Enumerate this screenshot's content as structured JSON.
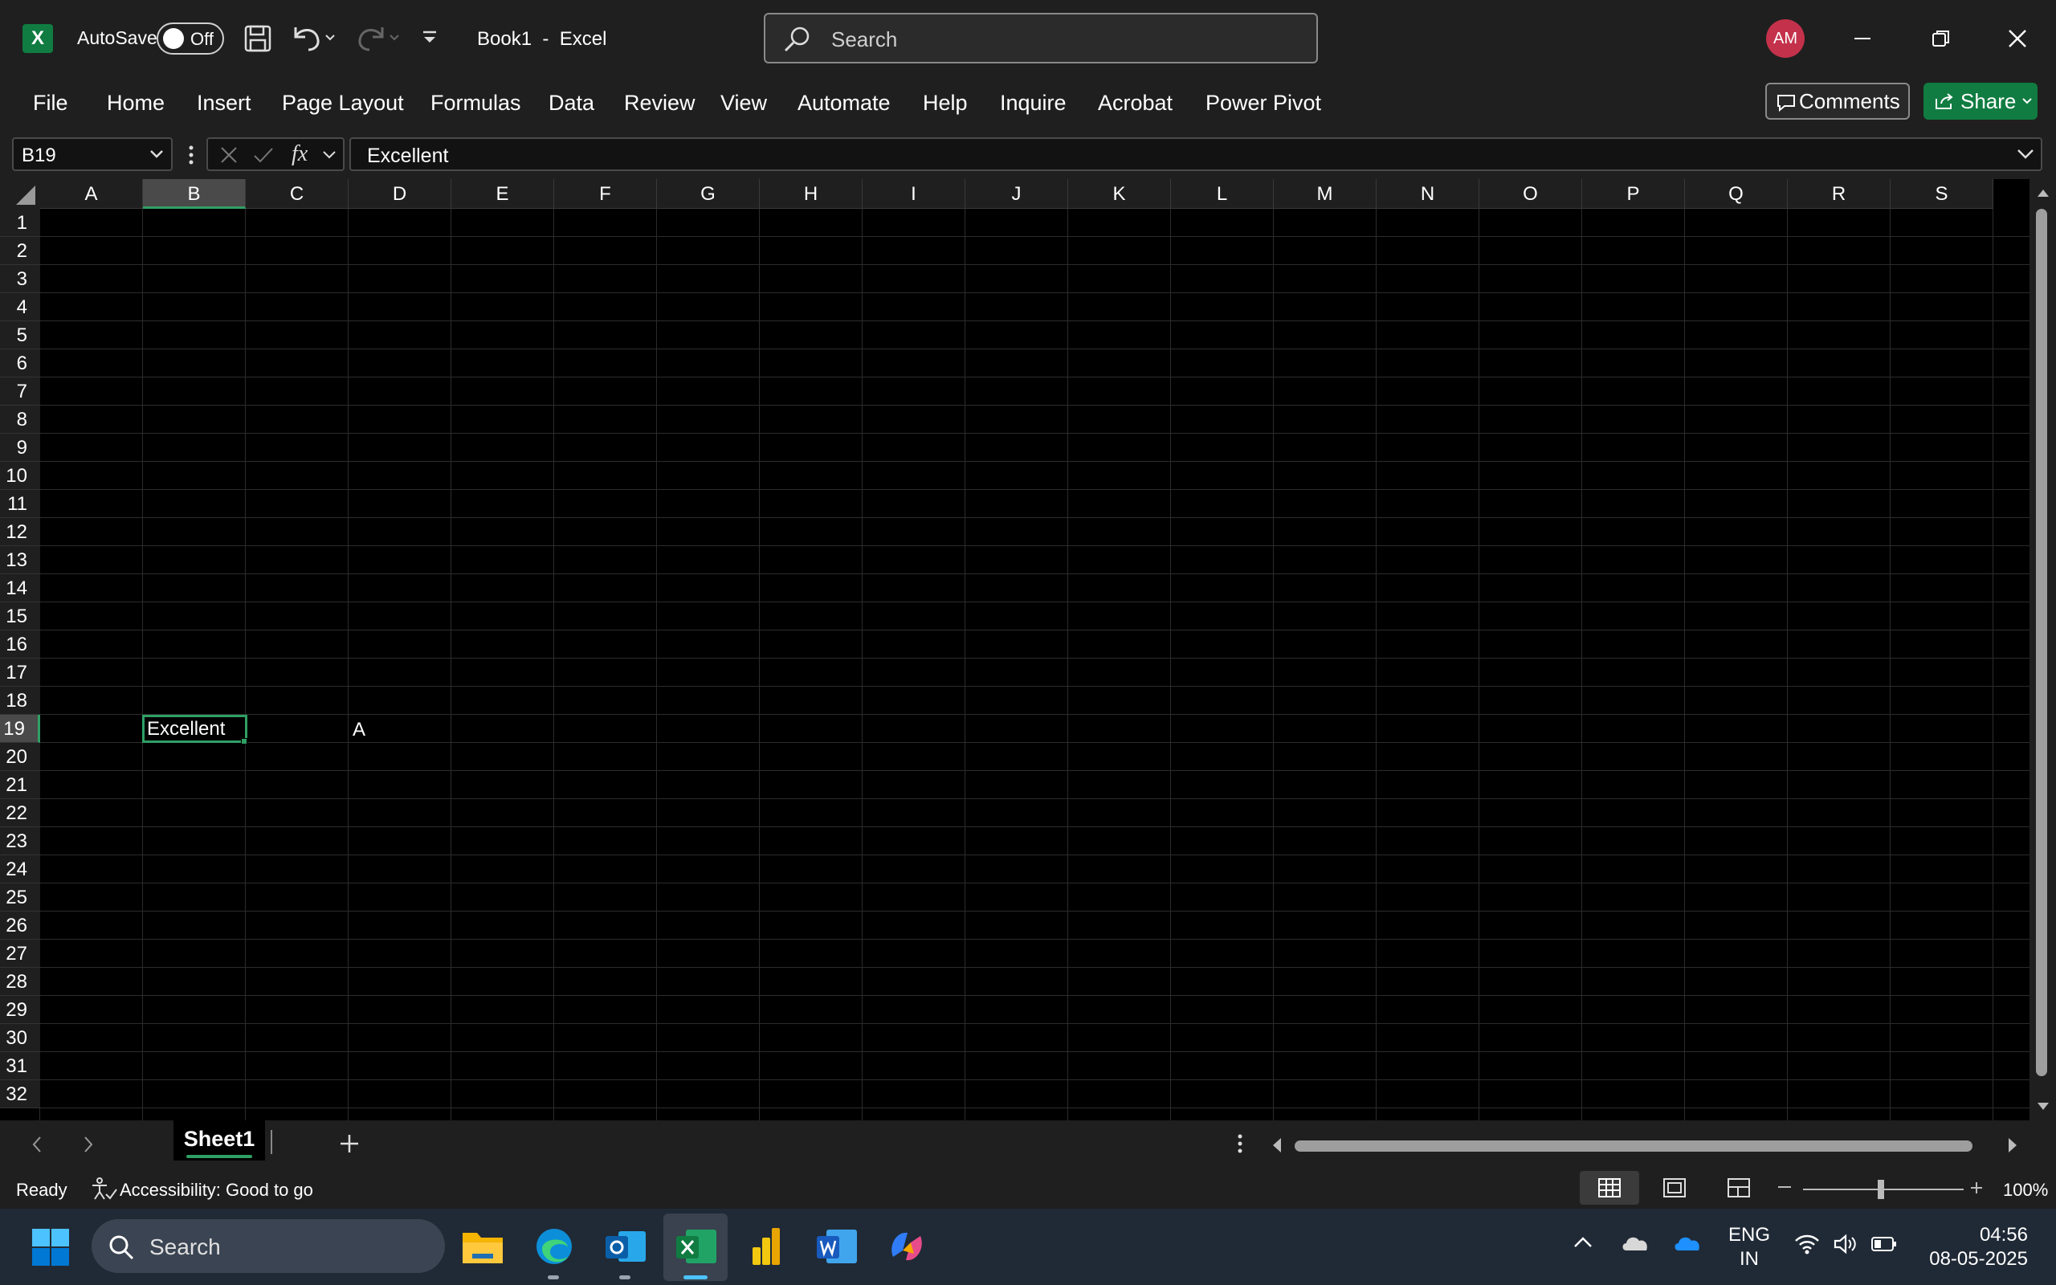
{
  "titlebar": {
    "app_icon_letter": "X",
    "autosave_label": "AutoSave",
    "autosave_state": "Off",
    "document_title": "Book1  -  Excel",
    "search_placeholder": "Search",
    "user_initials": "AM"
  },
  "ribbon": {
    "tabs": [
      "File",
      "Home",
      "Insert",
      "Page Layout",
      "Formulas",
      "Data",
      "Review",
      "View",
      "Automate",
      "Help",
      "Inquire",
      "Acrobat",
      "Power Pivot"
    ],
    "comments_label": "Comments",
    "share_label": "Share"
  },
  "formula_bar": {
    "name_box": "B19",
    "fx_label": "fx",
    "formula_value": "Excellent"
  },
  "grid": {
    "columns": [
      "A",
      "B",
      "C",
      "D",
      "E",
      "F",
      "G",
      "H",
      "I",
      "J",
      "K",
      "L",
      "M",
      "N",
      "O",
      "P",
      "Q",
      "R",
      "S"
    ],
    "rows": [
      "1",
      "2",
      "3",
      "4",
      "5",
      "6",
      "7",
      "8",
      "9",
      "10",
      "11",
      "12",
      "13",
      "14",
      "15",
      "16",
      "17",
      "18",
      "19",
      "20",
      "21",
      "22",
      "23",
      "24",
      "25",
      "26",
      "27",
      "28",
      "29",
      "30",
      "31",
      "32"
    ],
    "selected_column": "B",
    "selected_row": "19",
    "cells": {
      "B19": "Excellent",
      "D19": "A"
    }
  },
  "sheets": {
    "tabs": [
      "Sheet1"
    ],
    "active": "Sheet1"
  },
  "statusbar": {
    "ready": "Ready",
    "accessibility": "Accessibility: Good to go",
    "zoom": "100%"
  },
  "taskbar": {
    "search_placeholder": "Search",
    "lang_line1": "ENG",
    "lang_line2": "IN",
    "time": "04:56",
    "date": "08-05-2025"
  },
  "colors": {
    "accent_green": "#2fa065",
    "excel_green": "#107c41",
    "avatar_red": "#c4314b",
    "chrome_bg": "#1f1f1f"
  }
}
